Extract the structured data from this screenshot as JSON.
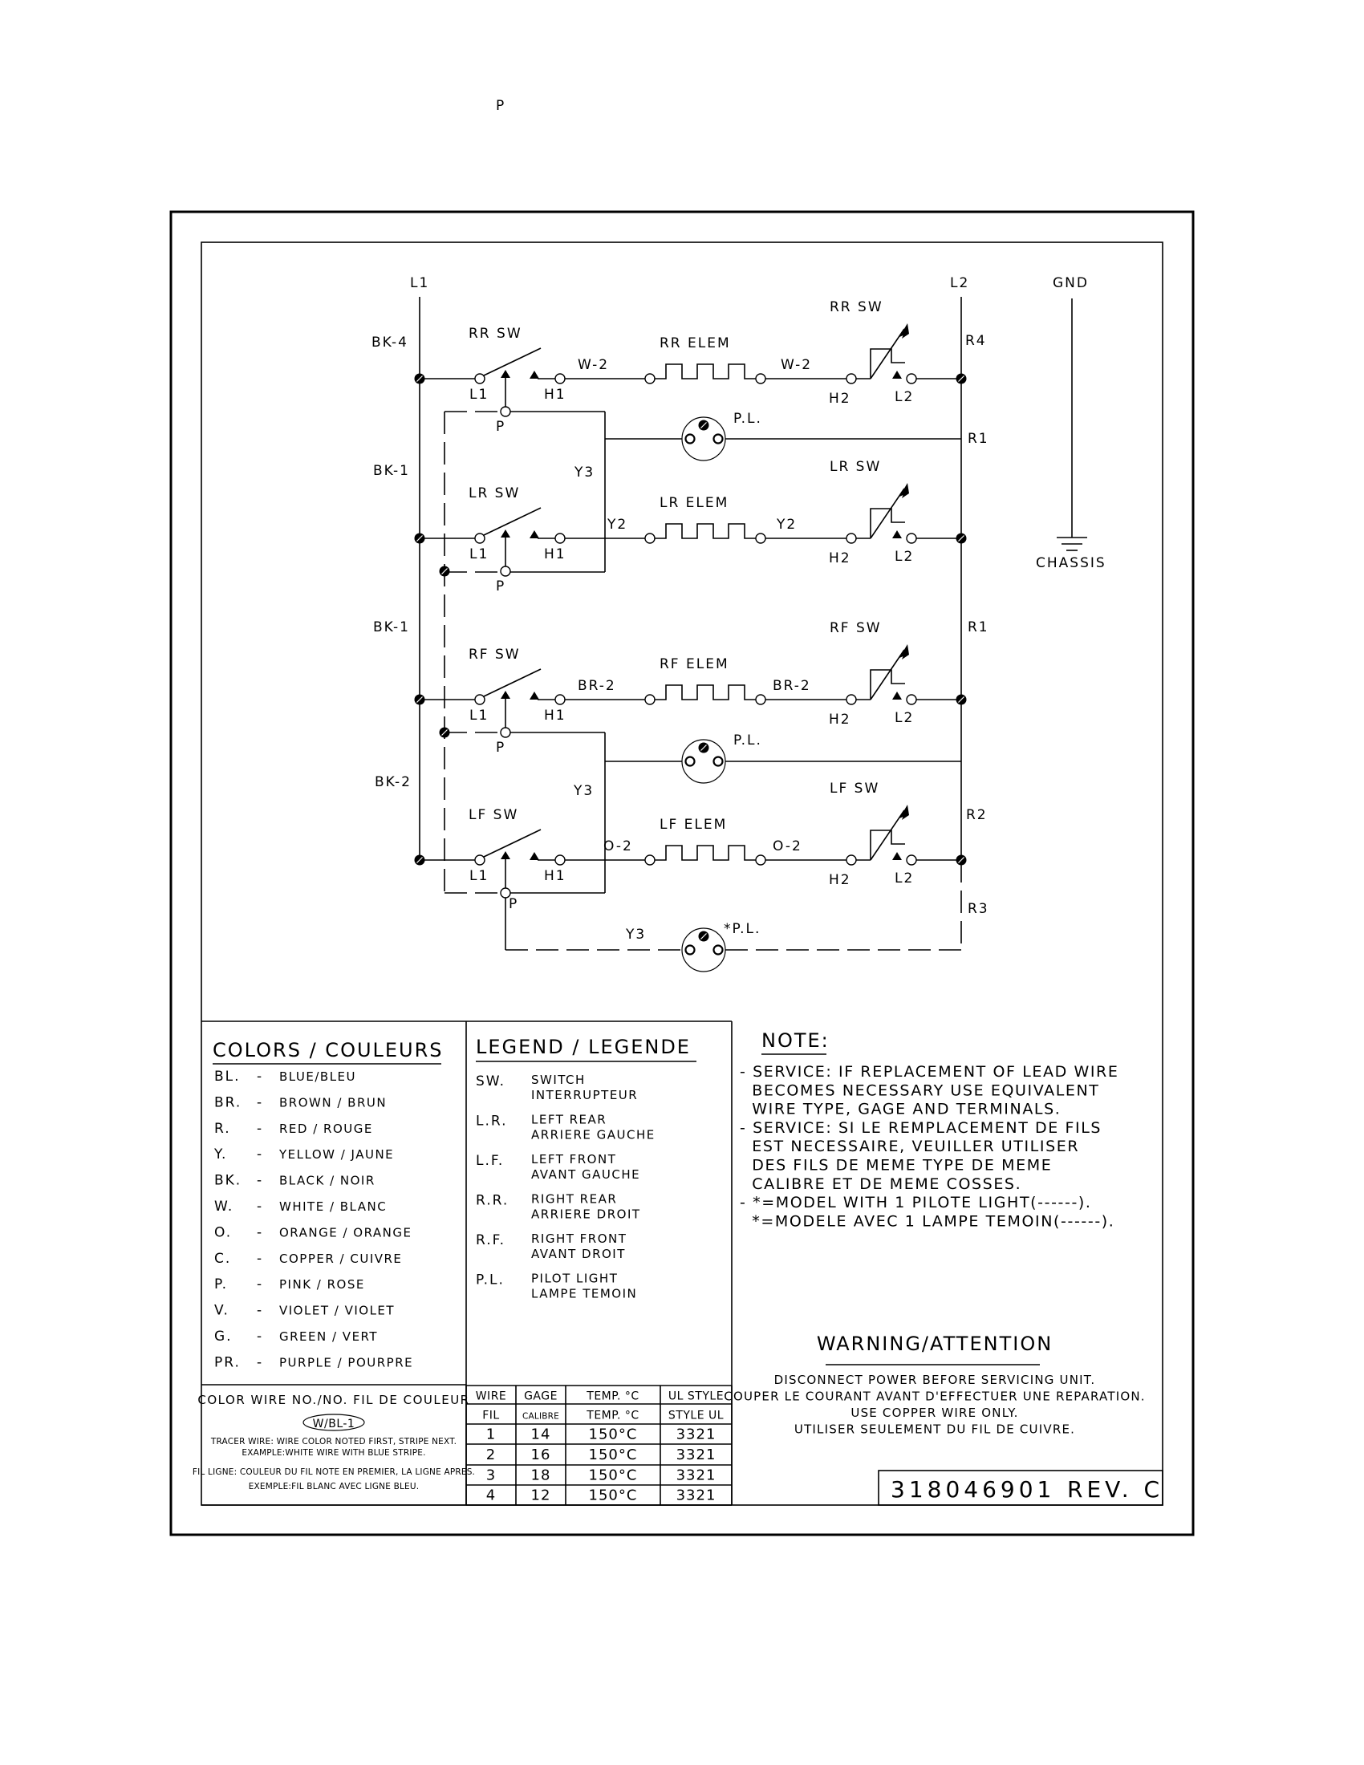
{
  "document": {
    "part_number": "318046901",
    "revision": "REV. C"
  },
  "schematic": {
    "rails": {
      "left": "L1",
      "right": "L2",
      "ground": "GND",
      "chassis": "CHASSIS"
    },
    "left_wires": [
      "BK-4",
      "BK-1",
      "BK-1",
      "BK-2"
    ],
    "right_wires": [
      "R4",
      "R1",
      "R1",
      "R2",
      "R3"
    ],
    "circuits": [
      {
        "switch": "RR SW",
        "element": "RR ELEM",
        "wire_left": "W-2",
        "wire_right": "W-2",
        "infinite_switch": "RR SW"
      },
      {
        "switch": "LR SW",
        "element": "LR ELEM",
        "wire_left": "Y2",
        "wire_right": "Y2",
        "infinite_switch": "LR SW"
      },
      {
        "switch": "RF SW",
        "element": "RF ELEM",
        "wire_left": "BR-2",
        "wire_right": "BR-2",
        "infinite_switch": "RF SW"
      },
      {
        "switch": "LF SW",
        "element": "LF ELEM",
        "wire_left": "O-2",
        "wire_right": "O-2",
        "infinite_switch": "LF SW"
      }
    ],
    "terminals": {
      "l1": "L1",
      "h1": "H1",
      "h2": "H2",
      "l2": "L2",
      "p": "P"
    },
    "pilot_wire": "Y3",
    "pilot_light": "P.L.",
    "pilot_light_optional": "*P.L."
  },
  "colors": {
    "title": "COLORS / COULEURS",
    "items": [
      {
        "code": "BL.",
        "name": "BLUE/BLEU"
      },
      {
        "code": "BR.",
        "name": "BROWN / BRUN"
      },
      {
        "code": "R.",
        "name": "RED / ROUGE"
      },
      {
        "code": "Y.",
        "name": "YELLOW / JAUNE"
      },
      {
        "code": "BK.",
        "name": "BLACK / NOIR"
      },
      {
        "code": "W.",
        "name": "WHITE / BLANC"
      },
      {
        "code": "O.",
        "name": "ORANGE / ORANGE"
      },
      {
        "code": "C.",
        "name": "COPPER / CUIVRE"
      },
      {
        "code": "P.",
        "name": "PINK / ROSE"
      },
      {
        "code": "V.",
        "name": "VIOLET / VIOLET"
      },
      {
        "code": "G.",
        "name": "GREEN / VERT"
      },
      {
        "code": "PR.",
        "name": "PURPLE / POURPRE"
      }
    ],
    "wire_no_title": "COLOR WIRE NO./NO. FIL DE COULEUR",
    "wire_example": "W/BL-1",
    "tracer_1": "TRACER WIRE: WIRE COLOR NOTED FIRST, STRIPE NEXT.",
    "tracer_2": "EXAMPLE:WHITE WIRE WITH BLUE STRIPE.",
    "fil_1": "FIL LIGNE: COULEUR DU FIL NOTE EN PREMIER, LA LIGNE APRES.",
    "fil_2": "EXEMPLE:FIL BLANC AVEC LIGNE BLEU."
  },
  "legend": {
    "title": "LEGEND / LEGENDE",
    "items": [
      {
        "code": "SW.",
        "line1": "SWITCH",
        "line2": "INTERRUPTEUR"
      },
      {
        "code": "L.R.",
        "line1": "LEFT REAR",
        "line2": "ARRIERE GAUCHE"
      },
      {
        "code": "L.F.",
        "line1": "LEFT FRONT",
        "line2": "AVANT GAUCHE"
      },
      {
        "code": "R.R.",
        "line1": "RIGHT REAR",
        "line2": "ARRIERE DROIT"
      },
      {
        "code": "R.F.",
        "line1": "RIGHT FRONT",
        "line2": "AVANT DROIT"
      },
      {
        "code": "P.L.",
        "line1": "PILOT LIGHT",
        "line2": "LAMPE TEMOIN"
      }
    ]
  },
  "wire_table": {
    "headers": [
      "WIRE",
      "GAGE",
      "TEMP.  °C",
      "UL STYLE"
    ],
    "headers_fr": [
      "FIL",
      "CALIBRE",
      "TEMP. °C",
      "STYLE UL"
    ],
    "rows": [
      [
        "1",
        "14",
        "150°C",
        "3321"
      ],
      [
        "2",
        "16",
        "150°C",
        "3321"
      ],
      [
        "3",
        "18",
        "150°C",
        "3321"
      ],
      [
        "4",
        "12",
        "150°C",
        "3321"
      ]
    ]
  },
  "note": {
    "title": "NOTE:",
    "lines": [
      "- SERVICE: IF REPLACEMENT OF LEAD WIRE",
      "  BECOMES NECESSARY USE EQUIVALENT",
      "  WIRE TYPE, GAGE AND TERMINALS.",
      "- SERVICE: SI LE REMPLACEMENT DE FILS",
      "  EST NECESSAIRE, VEUILLER UTILISER",
      "  DES FILS DE MEME TYPE DE MEME",
      "  CALIBRE ET DE MEME COSSES.",
      "- *=MODEL WITH 1 PILOTE LIGHT(------).",
      "  *=MODELE AVEC 1 LAMPE TEMOIN(------)."
    ]
  },
  "warning": {
    "title": "WARNING/ATTENTION",
    "lines": [
      "DISCONNECT POWER BEFORE SERVICING UNIT.",
      "COUPER LE COURANT AVANT D'EFFECTUER UNE REPARATION.",
      "USE COPPER WIRE ONLY.",
      "UTILISER SEULEMENT DU FIL DE CUIVRE."
    ]
  }
}
